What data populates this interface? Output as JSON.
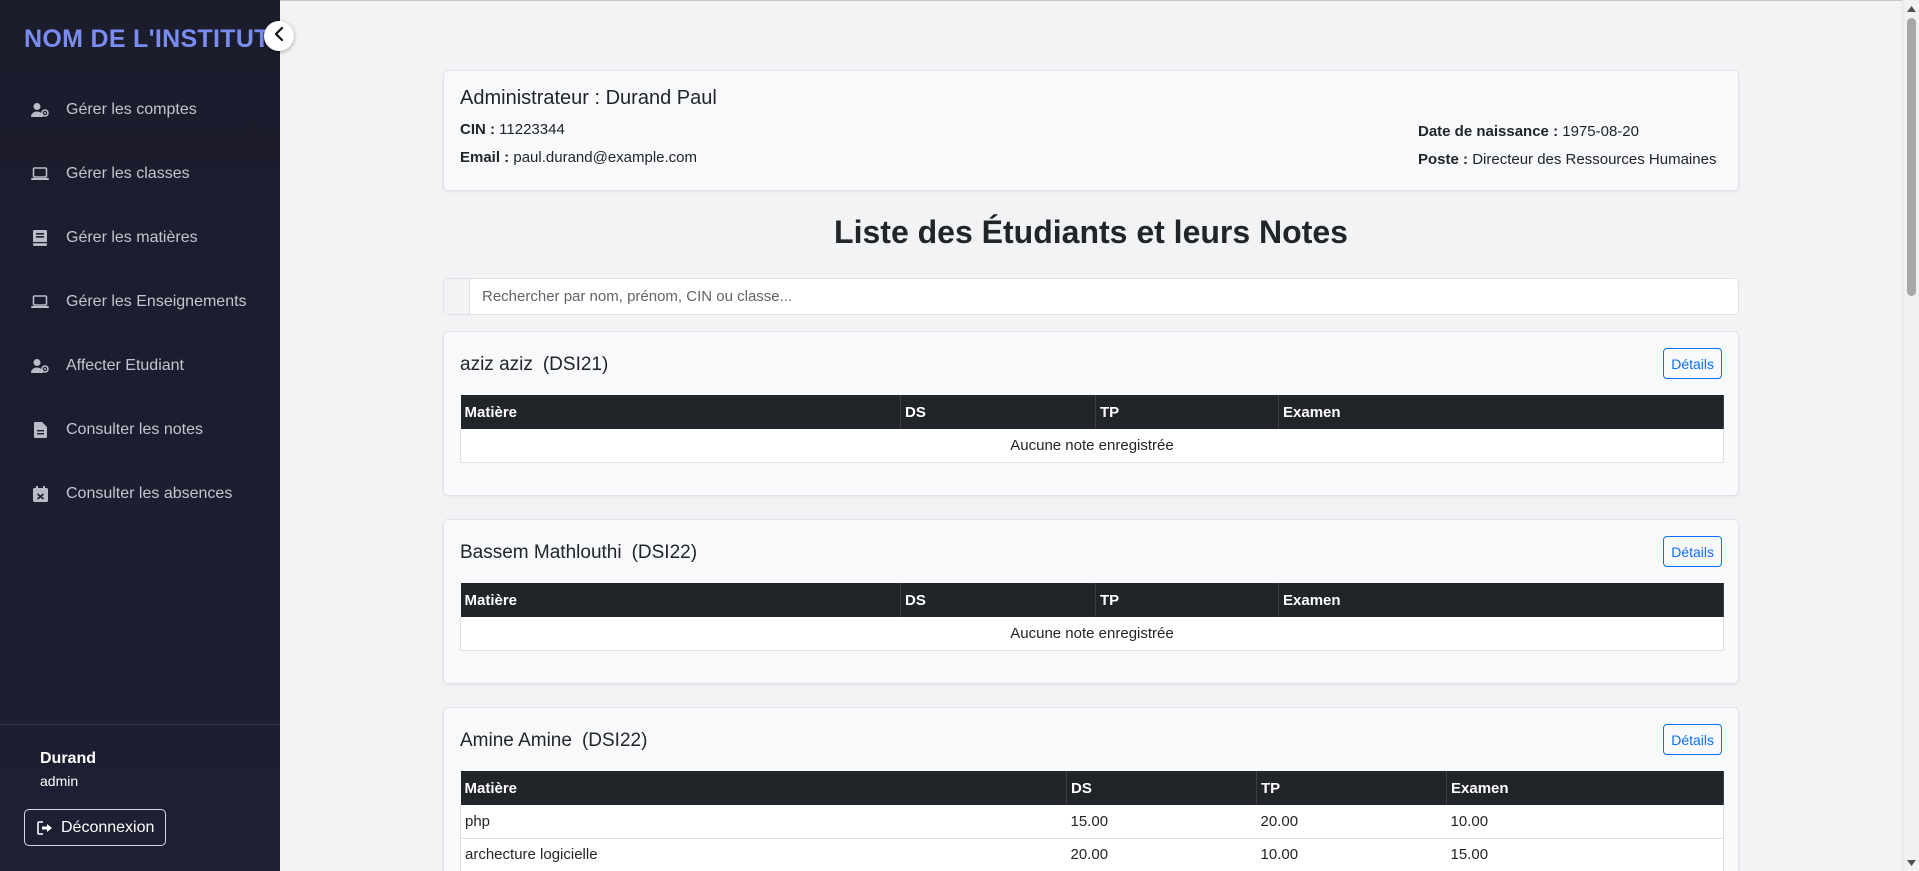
{
  "sidebar": {
    "brand": "NOM DE L'INSTITUT",
    "items": [
      {
        "label": "Gérer les comptes",
        "icon": "user-gear-icon"
      },
      {
        "label": "Gérer les classes",
        "icon": "laptop-icon"
      },
      {
        "label": "Gérer les matières",
        "icon": "book-icon"
      },
      {
        "label": "Gérer les Enseignements",
        "icon": "laptop-icon"
      },
      {
        "label": "Affecter Etudiant",
        "icon": "user-gear-icon"
      },
      {
        "label": "Consulter les notes",
        "icon": "file-icon"
      },
      {
        "label": "Consulter les absences",
        "icon": "calendar-x-icon"
      }
    ],
    "user": {
      "name": "Durand",
      "role": "admin"
    },
    "logout_label": "Déconnexion"
  },
  "profile": {
    "title": "Administrateur : Durand Paul",
    "cin_label": "CIN :",
    "cin": "11223344",
    "email_label": "Email :",
    "email": "paul.durand@example.com",
    "dob_label": "Date de naissance :",
    "dob": "1975-08-20",
    "poste_label": "Poste :",
    "poste": "Directeur des Ressources Humaines"
  },
  "page_title": "Liste des Étudiants et leurs Notes",
  "search": {
    "placeholder": "Rechercher par nom, prénom, CIN ou classe..."
  },
  "columns": [
    "Matière",
    "DS",
    "TP",
    "Examen"
  ],
  "details_label": "Détails",
  "empty_label": "Aucune note enregistrée",
  "students": [
    {
      "name": "aziz aziz",
      "class": "(DSI21)",
      "notes": []
    },
    {
      "name": "Bassem Mathlouthi",
      "class": "(DSI22)",
      "notes": []
    },
    {
      "name": "Amine Amine",
      "class": "(DSI22)",
      "notes": [
        {
          "matiere": "php",
          "ds": "15.00",
          "tp": "20.00",
          "examen": "10.00"
        },
        {
          "matiere": "archecture logicielle",
          "ds": "20.00",
          "tp": "10.00",
          "examen": "15.00"
        }
      ]
    }
  ],
  "colors": {
    "sidebar_bg": "#1b1c2c",
    "brand": "#7a8cf0",
    "primary": "#0d6efd",
    "table_header": "#212529"
  }
}
